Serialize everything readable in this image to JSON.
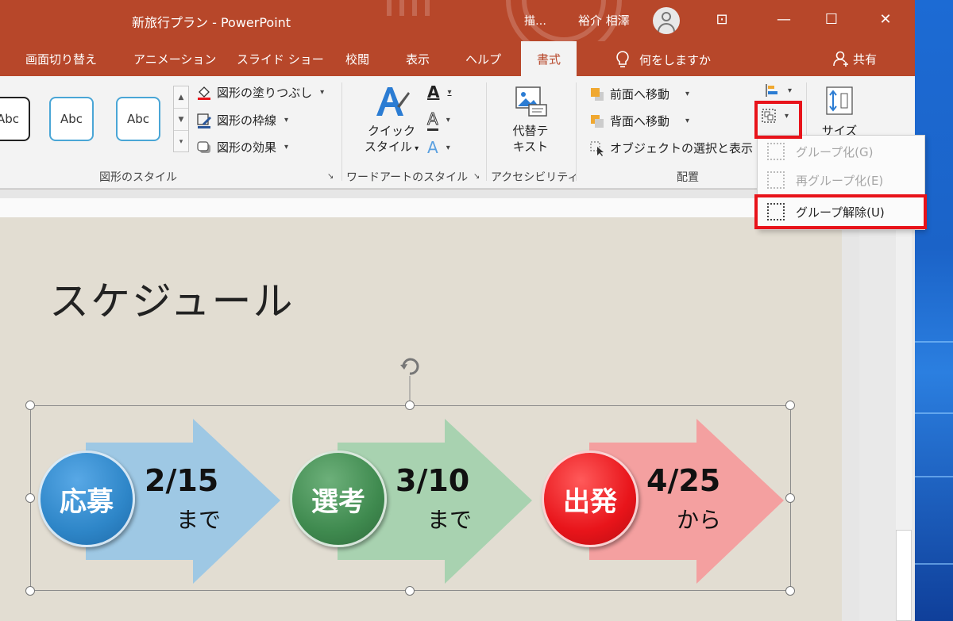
{
  "window": {
    "title": "新旅行プラン  -  PowerPoint",
    "search_short": "描…",
    "user_name": "裕介 相澤",
    "controls": {
      "ribbon_display": "⊡",
      "minimize": "—",
      "maximize": "☐",
      "close": "✕"
    }
  },
  "tabs": [
    "画面切り替え",
    "アニメーション",
    "スライド ショー",
    "校閲",
    "表示",
    "ヘルプ",
    "書式"
  ],
  "active_tab": "書式",
  "tell_me": "何をしますか",
  "share": "共有",
  "ribbon": {
    "shape_styles": {
      "gallery": [
        "Abc",
        "Abc",
        "Abc"
      ],
      "fill": "図形の塗りつぶし",
      "outline": "図形の枠線",
      "effects": "図形の効果",
      "label": "図形のスタイル"
    },
    "wordart": {
      "quick_style_line1": "クイック",
      "quick_style_line2": "スタイル",
      "text_fill_glyph": "A",
      "text_outline_glyph": "A",
      "text_effect_glyph": "A",
      "label": "ワードアートのスタイル"
    },
    "accessibility": {
      "alt_text_line1": "代替テ",
      "alt_text_line2": "キスト",
      "label": "アクセシビリティ"
    },
    "arrange": {
      "bring_forward": "前面へ移動",
      "send_backward": "背面へ移動",
      "selection_pane": "オブジェクトの選択と表示",
      "label": "配置"
    },
    "size": {
      "label": "サイズ"
    }
  },
  "group_menu": {
    "items": [
      {
        "label": "グループ化(G)",
        "enabled": false
      },
      {
        "label": "再グループ化(E)",
        "enabled": false
      },
      {
        "label": "グループ解除(U)",
        "enabled": true
      }
    ]
  },
  "slide": {
    "title": "スケジュール",
    "steps": [
      {
        "name": "応募",
        "date": "2/15",
        "suffix": "まで",
        "circle_color": "#2e86c8",
        "arrow_color": "#9ec8e4"
      },
      {
        "name": "選考",
        "date": "3/10",
        "suffix": "まで",
        "circle_color": "#3f8a4f",
        "arrow_color": "#a8d2b0"
      },
      {
        "name": "出発",
        "date": "4/25",
        "suffix": "から",
        "circle_color": "#e8141a",
        "arrow_color": "#f4a0a0"
      }
    ]
  },
  "colors": {
    "accent": "#b7472a",
    "highlight": "#e8131a"
  }
}
